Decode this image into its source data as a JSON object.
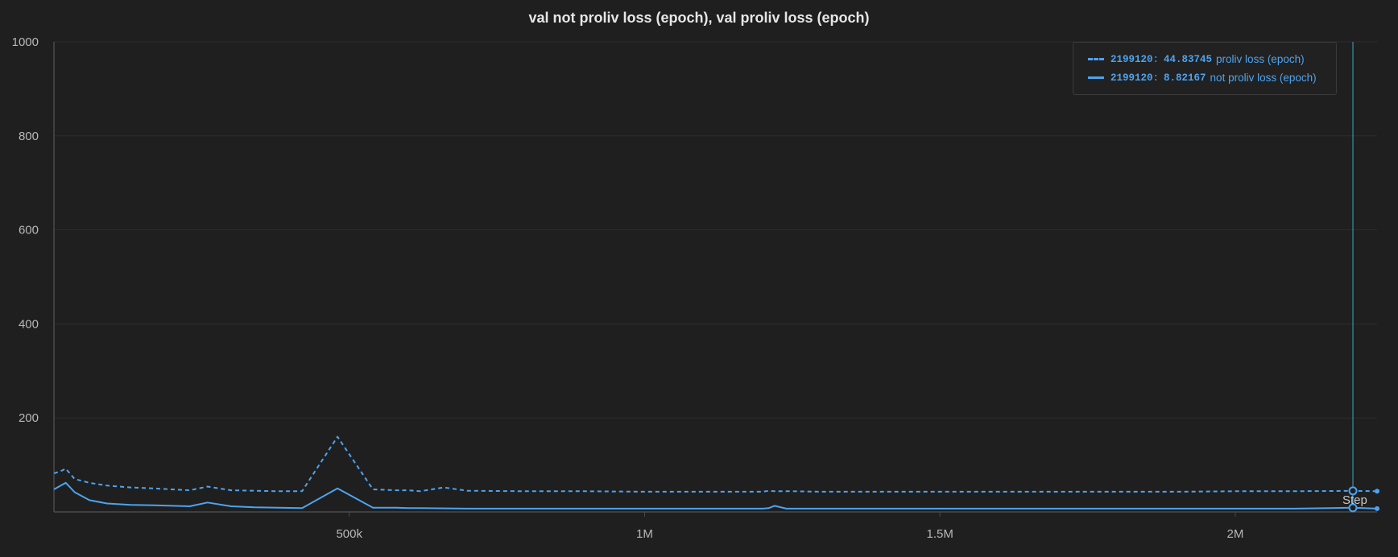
{
  "chart_data": {
    "type": "line",
    "title": "val not proliv loss (epoch), val proliv loss (epoch)",
    "xlabel": "Step",
    "ylabel": "",
    "xlim": [
      0,
      2240000
    ],
    "ylim": [
      0,
      1000
    ],
    "x_ticks": [
      {
        "value": 500000,
        "label": "500k"
      },
      {
        "value": 1000000,
        "label": "1M"
      },
      {
        "value": 1500000,
        "label": "1.5M"
      },
      {
        "value": 2000000,
        "label": "2M"
      }
    ],
    "y_ticks": [
      {
        "value": 200,
        "label": "200"
      },
      {
        "value": 400,
        "label": "400"
      },
      {
        "value": 600,
        "label": "600"
      },
      {
        "value": 800,
        "label": "800"
      },
      {
        "value": 1000,
        "label": "1000"
      }
    ],
    "grid": true,
    "legend_position": "top-right",
    "hover_step": 2199120,
    "series": [
      {
        "name": "proliv loss (epoch)",
        "hover_value": "44.83745",
        "style": "dashed",
        "color": "#4da3f0",
        "x": [
          0,
          10000,
          20000,
          35000,
          60000,
          90000,
          130000,
          170000,
          200000,
          230000,
          260000,
          300000,
          340000,
          380000,
          420000,
          480000,
          540000,
          580000,
          600000,
          620000,
          660000,
          700000,
          800000,
          900000,
          1000000,
          1100000,
          1200000,
          1210000,
          1220000,
          1250000,
          1300000,
          1400000,
          1500000,
          1600000,
          1700000,
          1800000,
          1900000,
          2000000,
          2100000,
          2199120,
          2240000
        ],
        "values": [
          82,
          86,
          92,
          70,
          62,
          56,
          52,
          50,
          48,
          46,
          54,
          46,
          45,
          44,
          44,
          160,
          48,
          46,
          46,
          44,
          52,
          45,
          44,
          44,
          43,
          43,
          43,
          45,
          44,
          44,
          43,
          43,
          43,
          43,
          43,
          43,
          43,
          44,
          44,
          44.83745,
          44
        ]
      },
      {
        "name": "not proliv loss (epoch)",
        "hover_value": "8.82167",
        "style": "solid",
        "color": "#4da3f0",
        "x": [
          0,
          10000,
          20000,
          35000,
          60000,
          90000,
          130000,
          170000,
          200000,
          230000,
          260000,
          300000,
          340000,
          380000,
          420000,
          480000,
          540000,
          580000,
          600000,
          620000,
          700000,
          800000,
          900000,
          1000000,
          1100000,
          1200000,
          1210000,
          1220000,
          1240000,
          1300000,
          1400000,
          1500000,
          1600000,
          1700000,
          1800000,
          1900000,
          2000000,
          2100000,
          2199120,
          2240000
        ],
        "values": [
          48,
          55,
          62,
          42,
          25,
          18,
          15,
          14,
          13,
          12,
          20,
          12,
          10,
          9,
          8,
          50,
          9,
          9,
          8,
          8,
          7,
          7,
          7,
          7,
          7,
          7,
          8,
          13,
          7,
          7,
          7,
          7,
          7,
          7,
          7,
          7,
          7,
          7,
          8.82167,
          7
        ]
      }
    ]
  }
}
